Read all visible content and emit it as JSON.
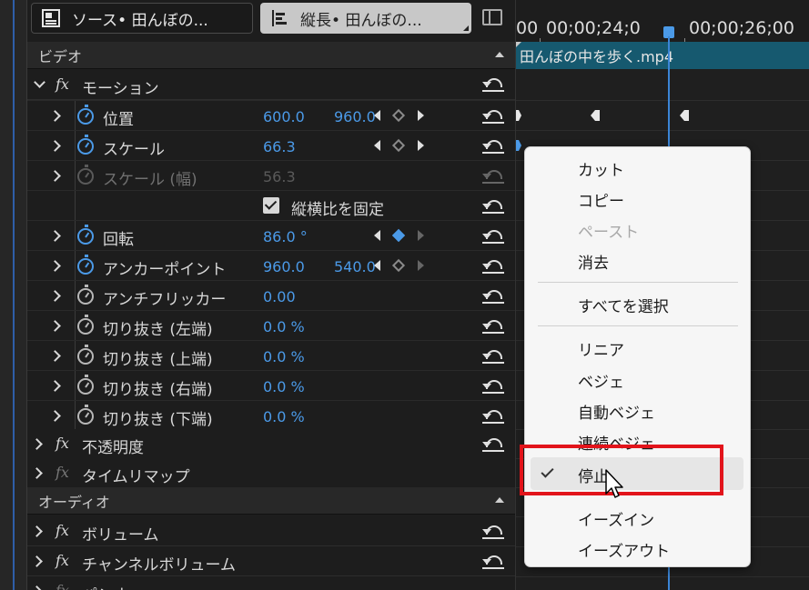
{
  "tabs": {
    "source": "ソース• 田んぼの...",
    "sequence": "縦長• 田んぼの..."
  },
  "sections": {
    "video": "ビデオ",
    "audio": "オーディオ"
  },
  "motion": {
    "fx": "fx",
    "label": "モーション"
  },
  "properties": [
    {
      "label": "位置",
      "v1": "600.0",
      "v2": "960.0"
    },
    {
      "label": "スケール",
      "v1": "66.3"
    },
    {
      "label": "スケール (幅)",
      "v1": "56.3"
    },
    {
      "label": "縦横比を固定"
    },
    {
      "label": "回転",
      "v1": "86.0 °"
    },
    {
      "label": "アンカーポイント",
      "v1": "960.0",
      "v2": "540.0"
    },
    {
      "label": "アンチフリッカー",
      "v1": "0.00"
    },
    {
      "label": "切り抜き (左端)",
      "v1": "0.0 %"
    },
    {
      "label": "切り抜き (上端)",
      "v1": "0.0 %"
    },
    {
      "label": "切り抜き (右端)",
      "v1": "0.0 %"
    },
    {
      "label": "切り抜き (下端)",
      "v1": "0.0 %"
    }
  ],
  "effects": {
    "opacity": "不透明度",
    "timeremap": "タイムリマップ",
    "volume": "ボリューム",
    "channel_volume": "チャンネルボリューム",
    "panner": "パンナー"
  },
  "timeline": {
    "tc_left": "00",
    "tc_mid": "00;00;24;0",
    "tc_right": "00;00;26;00",
    "clip_name": "田んぼの中を歩く.mp4"
  },
  "context_menu": {
    "items": [
      "カット",
      "コピー",
      "ペースト",
      "消去",
      "すべてを選択",
      "リニア",
      "ベジェ",
      "自動ベジェ",
      "連続ベジェ",
      "停止",
      "イーズイン",
      "イーズアウト"
    ],
    "disabled": [
      "ペースト"
    ],
    "checked": "停止"
  },
  "colors": {
    "accent": "#4b9ae8",
    "clip": "#16596f",
    "highlight_box": "#e2141b"
  }
}
